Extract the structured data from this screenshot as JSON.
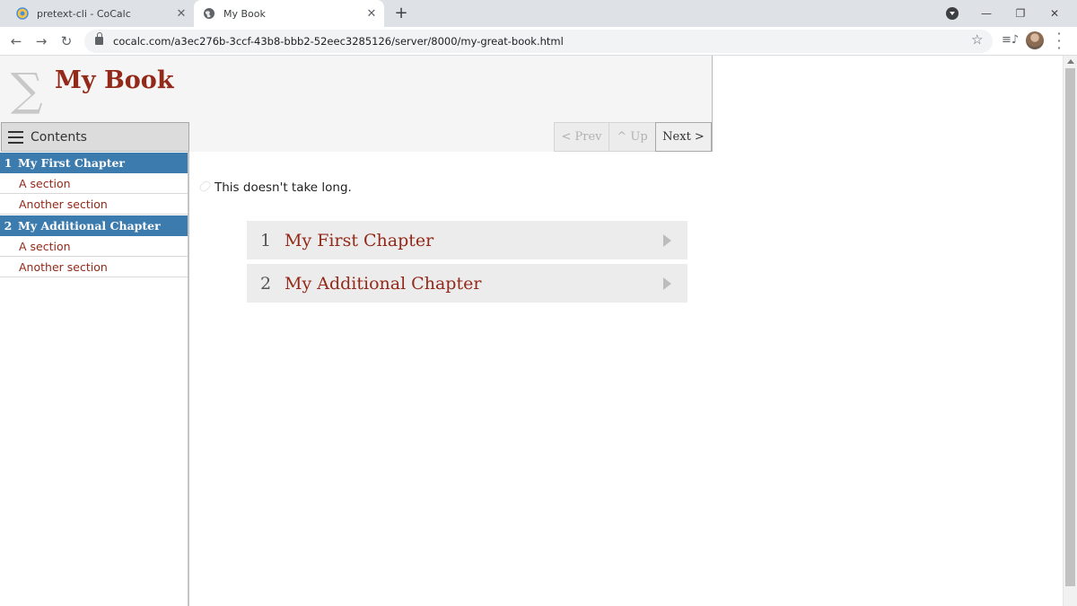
{
  "browser": {
    "tabs": [
      {
        "title": "pretext-cli - CoCalc",
        "icon": "cocalc-icon",
        "active": false
      },
      {
        "title": "My Book",
        "icon": "globe-icon",
        "active": true
      }
    ],
    "new_tab_label": "+",
    "url": "cocalc.com/a3ec276b-3ccf-43b8-bbb2-52eec3285126/server/8000/my-great-book.html"
  },
  "header": {
    "logo_glyph": "∑",
    "title": "My Book",
    "toc_button_label": "Contents",
    "nav": {
      "prev_label": "< Prev",
      "up_label": "^ Up",
      "next_label": "Next >"
    }
  },
  "sidebar": {
    "chapters": [
      {
        "number": "1",
        "title": "My First Chapter",
        "sections": [
          "A section",
          "Another section"
        ]
      },
      {
        "number": "2",
        "title": "My Additional Chapter",
        "sections": [
          "A section",
          "Another section"
        ]
      }
    ]
  },
  "main": {
    "intro": "This doesn't take long.",
    "toc_cards": [
      {
        "number": "1",
        "title": "My First Chapter"
      },
      {
        "number": "2",
        "title": "My Additional Chapter"
      }
    ]
  },
  "colors": {
    "accent": "#932919",
    "chapter_highlight": "#3b7bad",
    "header_bg": "#f5f5f5",
    "card_bg": "#ececec"
  }
}
